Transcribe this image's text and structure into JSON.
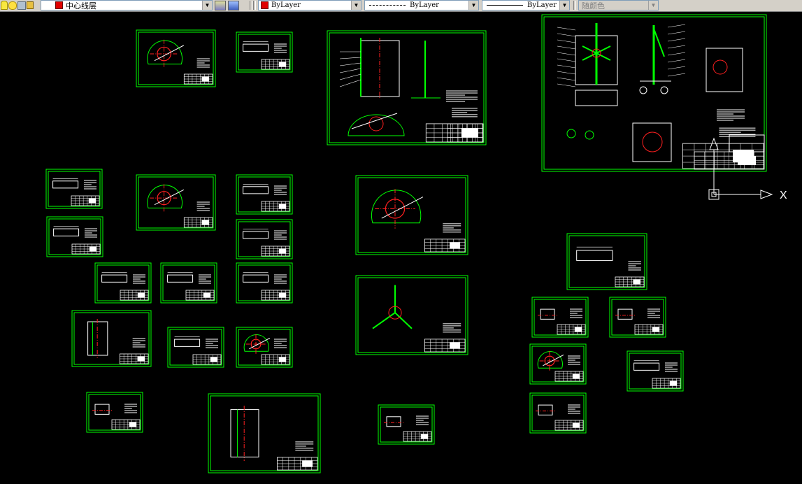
{
  "toolbar": {
    "layer_name": "中心线层",
    "color_value": "ByLayer",
    "linetype_value": "ByLayer",
    "lineweight_value": "ByLayer",
    "plotstyle_value": "随颜色",
    "colors": {
      "layer_swatch": "#e00000",
      "color_swatch": "#e00000"
    }
  },
  "ucs": {
    "x_label": "X"
  },
  "colors": {
    "sheet_border": "#00ff00",
    "geometry": "#ffffff",
    "centerline": "#ff2020",
    "annotation": "#00ff00"
  }
}
